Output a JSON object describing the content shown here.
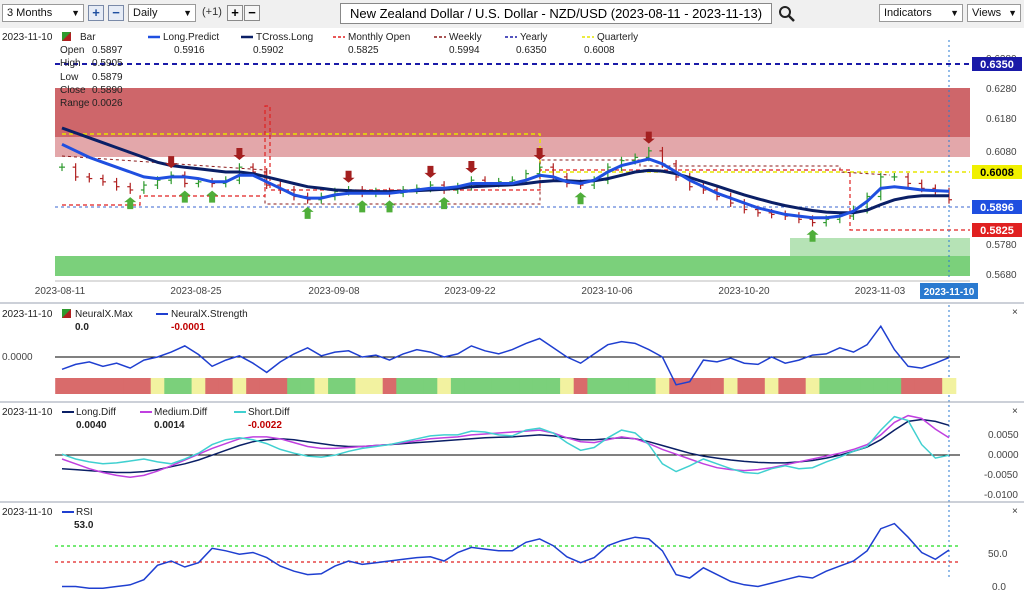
{
  "toolbar": {
    "period": "3 Months",
    "plus": "+",
    "minus": "−",
    "interval": "Daily",
    "offset": "(+1)",
    "plus2": "+",
    "minus2": "−",
    "title": "New Zealand Dollar / U.S. Dollar - NZD/USD (2023-08-11 - 2023-11-13)",
    "indicators": "Indicators",
    "views": "Views"
  },
  "main_panel": {
    "date": "2023-11-10",
    "legend": {
      "bar": "Bar",
      "bar_fields": [
        {
          "label": "Open",
          "value": "0.5897"
        },
        {
          "label": "High",
          "value": "0.5905"
        },
        {
          "label": "Low",
          "value": "0.5879"
        },
        {
          "label": "Close",
          "value": "0.5890"
        },
        {
          "label": "Range",
          "value": "0.0026"
        }
      ],
      "long_predict": {
        "name": "Long.Predict",
        "value": "0.5916"
      },
      "tcross_long": {
        "name": "TCross.Long",
        "value": "0.5902"
      },
      "monthly_open": {
        "name": "Monthly Open",
        "value": "0.5825"
      },
      "weekly": {
        "name": "Weekly",
        "value": "0.5994"
      },
      "yearly": {
        "name": "Yearly",
        "value": "0.6350"
      },
      "quarterly": {
        "name": "Quarterly",
        "value": "0.6008"
      }
    },
    "y_ticks": [
      "0.6280",
      "0.6180",
      "0.6080",
      "0.5780",
      "0.5680"
    ],
    "price_tags": {
      "yearly": "0.6350",
      "quarterly": "0.6008",
      "current": "0.5896",
      "monthly": "0.5825"
    },
    "x_ticks": [
      "2023-08-11",
      "2023-08-25",
      "2023-09-08",
      "2023-09-22",
      "2023-10-06",
      "2023-10-20",
      "2023-11-03"
    ],
    "x_current": "2023-11-10"
  },
  "neural_panel": {
    "date": "2023-11-10",
    "max": {
      "name": "NeuralX.Max",
      "value": "0.0"
    },
    "strength": {
      "name": "NeuralX.Strength",
      "value": "-0.0001"
    },
    "y_tick": "0.0000"
  },
  "diff_panel": {
    "date": "2023-11-10",
    "long": {
      "name": "Long.Diff",
      "value": "0.0040"
    },
    "medium": {
      "name": "Medium.Diff",
      "value": "0.0014"
    },
    "short": {
      "name": "Short.Diff",
      "value": "-0.0022"
    },
    "y_ticks": [
      "0.0050",
      "0.0000",
      "-0.0050",
      "-0.0100"
    ]
  },
  "rsi_panel": {
    "date": "2023-11-10",
    "rsi": {
      "name": "RSI",
      "value": "53.0"
    },
    "y_ticks": [
      "50.0",
      "0.0"
    ]
  },
  "colors": {
    "long_predict": "#1f4fe0",
    "tcross_long": "#0a1f66",
    "monthly_open": "#e02020",
    "weekly": "#8b1a1a",
    "yearly": "#1a1aa8",
    "quarterly": "#e6e600",
    "resistance_zone": "#c9555a",
    "support_zone": "#7bd07b",
    "bull_arrow": "#4fae3a",
    "bear_arrow": "#a31f1f",
    "medium_diff": "#c040e0",
    "short_diff": "#40d0d0"
  },
  "chart_data": [
    {
      "type": "line",
      "title": "New Zealand Dollar / U.S. Dollar - NZD/USD (2023-08-11 - 2023-11-13)",
      "x": [
        "2023-08-11",
        "2023-08-14",
        "2023-08-15",
        "2023-08-16",
        "2023-08-17",
        "2023-08-18",
        "2023-08-21",
        "2023-08-22",
        "2023-08-23",
        "2023-08-24",
        "2023-08-25",
        "2023-08-28",
        "2023-08-29",
        "2023-08-30",
        "2023-08-31",
        "2023-09-01",
        "2023-09-04",
        "2023-09-05",
        "2023-09-06",
        "2023-09-07",
        "2023-09-08",
        "2023-09-11",
        "2023-09-12",
        "2023-09-13",
        "2023-09-14",
        "2023-09-15",
        "2023-09-18",
        "2023-09-19",
        "2023-09-20",
        "2023-09-21",
        "2023-09-22",
        "2023-09-25",
        "2023-09-26",
        "2023-09-27",
        "2023-09-28",
        "2023-09-29",
        "2023-10-02",
        "2023-10-03",
        "2023-10-04",
        "2023-10-05",
        "2023-10-06",
        "2023-10-09",
        "2023-10-10",
        "2023-10-11",
        "2023-10-12",
        "2023-10-13",
        "2023-10-16",
        "2023-10-17",
        "2023-10-18",
        "2023-10-19",
        "2023-10-20",
        "2023-10-23",
        "2023-10-24",
        "2023-10-25",
        "2023-10-26",
        "2023-10-27",
        "2023-10-30",
        "2023-10-31",
        "2023-11-01",
        "2023-11-02",
        "2023-11-03",
        "2023-11-06",
        "2023-11-07",
        "2023-11-08",
        "2023-11-09",
        "2023-11-10"
      ],
      "ylim": [
        0.565,
        0.638
      ],
      "series": [
        {
          "name": "Bar (Close)",
          "values": [
            0.599,
            0.596,
            0.5955,
            0.5945,
            0.593,
            0.592,
            0.5935,
            0.595,
            0.5965,
            0.594,
            0.5945,
            0.594,
            0.595,
            0.599,
            0.5975,
            0.5935,
            0.592,
            0.59,
            0.589,
            0.59,
            0.5915,
            0.592,
            0.591,
            0.5915,
            0.591,
            0.592,
            0.5925,
            0.5935,
            0.592,
            0.593,
            0.595,
            0.594,
            0.5945,
            0.595,
            0.597,
            0.599,
            0.596,
            0.594,
            0.5935,
            0.595,
            0.599,
            0.601,
            0.602,
            0.604,
            0.6,
            0.596,
            0.593,
            0.592,
            0.59,
            0.588,
            0.586,
            0.585,
            0.5845,
            0.584,
            0.583,
            0.582,
            0.583,
            0.584,
            0.586,
            0.59,
            0.596,
            0.596,
            0.594,
            0.5925,
            0.5915,
            0.589
          ]
        },
        {
          "name": "Long.Predict",
          "values": [
            0.606,
            0.604,
            0.602,
            0.6005,
            0.599,
            0.5975,
            0.596,
            0.5955,
            0.596,
            0.596,
            0.5955,
            0.5945,
            0.5945,
            0.5965,
            0.5965,
            0.5945,
            0.5925,
            0.5905,
            0.5895,
            0.5895,
            0.5905,
            0.591,
            0.591,
            0.591,
            0.591,
            0.5915,
            0.592,
            0.5925,
            0.5925,
            0.593,
            0.594,
            0.594,
            0.594,
            0.594,
            0.595,
            0.5965,
            0.596,
            0.5945,
            0.594,
            0.595,
            0.5975,
            0.5995,
            0.6005,
            0.6015,
            0.6,
            0.5975,
            0.595,
            0.593,
            0.591,
            0.5895,
            0.588,
            0.5865,
            0.5855,
            0.5845,
            0.584,
            0.5835,
            0.5835,
            0.584,
            0.5855,
            0.5885,
            0.5925,
            0.593,
            0.5925,
            0.592,
            0.5918,
            0.5916
          ]
        },
        {
          "name": "TCross.Long",
          "values": [
            0.611,
            0.6095,
            0.608,
            0.6065,
            0.605,
            0.6035,
            0.602,
            0.6005,
            0.5995,
            0.599,
            0.5985,
            0.598,
            0.5975,
            0.5975,
            0.597,
            0.596,
            0.595,
            0.594,
            0.593,
            0.5925,
            0.592,
            0.5918,
            0.5916,
            0.5915,
            0.5915,
            0.5916,
            0.5918,
            0.592,
            0.5922,
            0.5925,
            0.593,
            0.5932,
            0.5934,
            0.5936,
            0.594,
            0.5945,
            0.5948,
            0.5948,
            0.5946,
            0.5948,
            0.5955,
            0.5965,
            0.5975,
            0.598,
            0.5978,
            0.597,
            0.5958,
            0.5945,
            0.5932,
            0.5918,
            0.5905,
            0.5893,
            0.5882,
            0.5872,
            0.5864,
            0.5857,
            0.5852,
            0.585,
            0.585,
            0.5858,
            0.5875,
            0.589,
            0.5898,
            0.5902,
            0.5902,
            0.5902
          ]
        }
      ],
      "levels": [
        {
          "name": "Yearly",
          "value": 0.635
        },
        {
          "name": "Quarterly",
          "value": 0.6008
        },
        {
          "name": "Monthly Open",
          "value": 0.5825
        },
        {
          "name": "Weekly",
          "value": 0.5994
        }
      ],
      "y_ticks": [
        0.628,
        0.618,
        0.608,
        0.578,
        0.568
      ]
    },
    {
      "type": "line",
      "x": "shared",
      "ylim": [
        -0.006,
        0.006
      ],
      "series": [
        {
          "name": "NeuralX.Strength",
          "values": [
            -0.002,
            -0.0012,
            -0.0008,
            -0.0015,
            -0.001,
            -0.0018,
            -0.0005,
            0.0,
            0.0008,
            0.0018,
            0.0004,
            -0.0015,
            -0.0005,
            0.0002,
            -0.001,
            -0.0025,
            -0.0008,
            0.0005,
            0.0015,
            0.0002,
            0.0008,
            0.001,
            0.0,
            0.0003,
            -0.0005,
            0.0005,
            0.0012,
            0.0008,
            0.0,
            0.0005,
            0.0018,
            0.001,
            0.0005,
            0.0012,
            0.0022,
            0.003,
            0.0015,
            0.0,
            -0.001,
            0.0005,
            0.002,
            0.0025,
            0.0022,
            0.0012,
            0.0,
            -0.0045,
            -0.004,
            -0.0005,
            -0.0008,
            -0.0002,
            -0.001,
            -0.0012,
            0.0,
            -0.001,
            -0.0005,
            0.0003,
            0.0005,
            0.0015,
            0.0008,
            0.002,
            0.005,
            0.0012,
            -0.0015,
            -0.0018,
            -0.001,
            -0.0001
          ]
        },
        {
          "name": "NeuralX.Max",
          "values": [
            0.0
          ]
        }
      ]
    },
    {
      "type": "line",
      "x": "shared",
      "ylim": [
        -0.0115,
        0.008
      ],
      "y_ticks": [
        0.005,
        0.0,
        -0.005,
        -0.01
      ],
      "series": [
        {
          "name": "Long.Diff",
          "values": [
            -0.005,
            -0.0052,
            -0.0054,
            -0.0056,
            -0.0058,
            -0.0058,
            -0.0056,
            -0.0052,
            -0.0046,
            -0.004,
            -0.0032,
            -0.0022,
            -0.0012,
            -0.0002,
            0.0006,
            0.001,
            0.0012,
            0.001,
            0.0006,
            0.0002,
            -0.0002,
            -0.0004,
            -0.0004,
            -0.0002,
            0.0,
            0.0002,
            0.0004,
            0.0006,
            0.0008,
            0.001,
            0.0012,
            0.0014,
            0.0015,
            0.0016,
            0.0018,
            0.002,
            0.0018,
            0.0014,
            0.001,
            0.001,
            0.0012,
            0.0014,
            0.0012,
            0.0006,
            -0.0002,
            -0.001,
            -0.0018,
            -0.0024,
            -0.0028,
            -0.0032,
            -0.0035,
            -0.0037,
            -0.0038,
            -0.0038,
            -0.0036,
            -0.0033,
            -0.0028,
            -0.0022,
            -0.0014,
            -0.0005,
            0.001,
            0.003,
            0.0048,
            0.0052,
            0.0048,
            0.004
          ]
        },
        {
          "name": "Medium.Diff",
          "values": [
            -0.003,
            -0.004,
            -0.005,
            -0.0058,
            -0.0064,
            -0.0068,
            -0.0064,
            -0.0055,
            -0.0044,
            -0.0032,
            -0.002,
            -0.0008,
            0.0002,
            0.0012,
            0.0016,
            0.0016,
            0.0012,
            0.0004,
            -0.0004,
            -0.0008,
            -0.0008,
            -0.0006,
            -0.0004,
            -0.0002,
            0.0,
            0.0004,
            0.0008,
            0.0012,
            0.0014,
            0.0016,
            0.002,
            0.0022,
            0.0024,
            0.0026,
            0.0028,
            0.003,
            0.0024,
            0.0014,
            0.0006,
            0.0004,
            0.001,
            0.0016,
            0.0012,
            0.0002,
            -0.001,
            -0.002,
            -0.003,
            -0.004,
            -0.0048,
            -0.0052,
            -0.0054,
            -0.0052,
            -0.0048,
            -0.0042,
            -0.0036,
            -0.003,
            -0.0024,
            -0.0018,
            -0.001,
            0.0,
            0.002,
            0.0046,
            0.006,
            0.0054,
            0.0032,
            0.0014
          ]
        },
        {
          "name": "Short.Diff",
          "values": [
            -0.002,
            -0.003,
            -0.0036,
            -0.004,
            -0.0038,
            -0.0034,
            -0.003,
            -0.0036,
            -0.004,
            -0.003,
            -0.0018,
            0.0,
            0.001,
            0.0014,
            0.001,
            0.0002,
            -0.001,
            -0.0018,
            -0.0024,
            -0.0026,
            -0.0022,
            -0.0014,
            -0.0008,
            -0.0004,
            0.0,
            0.0006,
            0.0012,
            0.0018,
            0.002,
            0.002,
            0.0028,
            0.0026,
            0.002,
            0.0018,
            0.003,
            0.0034,
            0.0024,
            0.0004,
            -0.0012,
            -0.0006,
            0.0014,
            0.003,
            0.0024,
            0.0,
            -0.004,
            -0.0056,
            -0.0044,
            -0.003,
            -0.004,
            -0.005,
            -0.0058,
            -0.006,
            -0.005,
            -0.0044,
            -0.005,
            -0.0048,
            -0.0036,
            -0.0026,
            -0.0014,
            -0.0004,
            0.003,
            0.0058,
            0.005,
            0.0,
            -0.0028,
            -0.0022
          ]
        }
      ]
    },
    {
      "type": "line",
      "x": "shared",
      "ylim": [
        0,
        100
      ],
      "y_ticks": [
        50.0,
        0.0
      ],
      "levels": [
        {
          "name": "Upper",
          "value": 60
        },
        {
          "name": "Lower",
          "value": 40
        }
      ],
      "series": [
        {
          "name": "RSI",
          "values": [
            10,
            10,
            8,
            8,
            10,
            12,
            18,
            35,
            40,
            33,
            38,
            55,
            52,
            48,
            50,
            44,
            34,
            28,
            24,
            25,
            34,
            40,
            36,
            38,
            40,
            42,
            44,
            45,
            40,
            50,
            56,
            54,
            52,
            52,
            62,
            66,
            58,
            45,
            38,
            44,
            58,
            64,
            68,
            66,
            52,
            24,
            20,
            32,
            24,
            16,
            12,
            10,
            14,
            18,
            22,
            20,
            28,
            34,
            40,
            52,
            78,
            84,
            68,
            50,
            42,
            53
          ]
        }
      ]
    }
  ]
}
